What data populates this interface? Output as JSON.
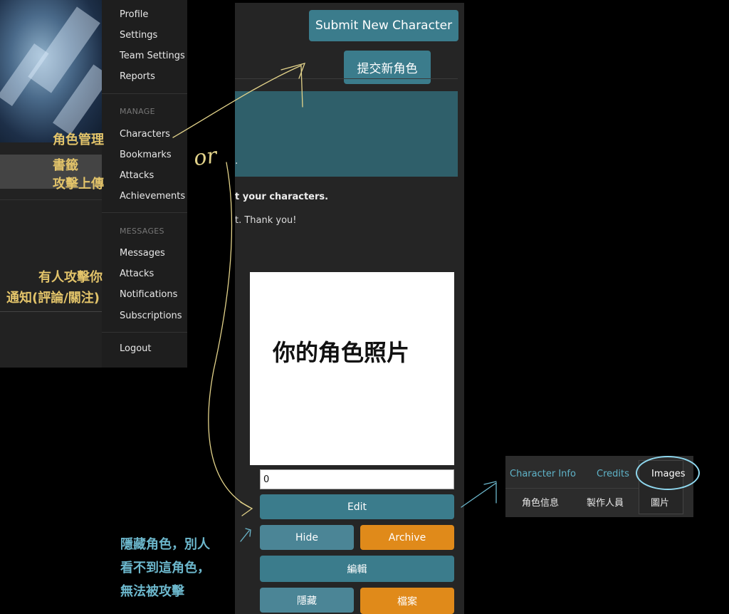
{
  "menu": {
    "account_items": [
      "Profile",
      "Settings",
      "Team Settings",
      "Reports"
    ],
    "manage_heading": "MANAGE",
    "manage_items": [
      "Characters",
      "Bookmarks",
      "Attacks",
      "Achievements"
    ],
    "messages_heading": "MESSAGES",
    "messages_items": [
      "Messages",
      "Attacks",
      "Notifications",
      "Subscriptions"
    ],
    "logout": "Logout"
  },
  "annotations_left": {
    "characters_zh": "角色管理",
    "bookmarks_zh": "書籤",
    "attacks_upload_zh": "攻擊上傳",
    "attacked_zh": "有人攻擊你",
    "notifications_zh": "通知(評論/關注)"
  },
  "handwritten_or": "or",
  "main": {
    "submit_en": "Submit New Character",
    "submit_zh": "提交新角色",
    "info_box_fragment": ".",
    "info_line1": "t your characters.",
    "info_line2": "t. Thank you!",
    "photo_label": "你的角色照片",
    "number_value": "0",
    "edit_label": "Edit",
    "hide_label": "Hide",
    "archive_label": "Archive",
    "edit_zh": "編輯",
    "hide_zh": "隱藏",
    "archive_zh": "檔案"
  },
  "hide_note": {
    "line1": "隱藏角色，別人",
    "line2": "看不到這角色，",
    "line3": "無法被攻擊"
  },
  "tabs": {
    "character_info": "Character Info",
    "credits": "Credits",
    "images": "Images",
    "character_info_zh": "角色信息",
    "credits_zh": "製作人員",
    "images_zh": "圖片"
  },
  "colors": {
    "teal": "#3b7c8c",
    "orange": "#e08a1a",
    "annotation_gold": "#e3c46a",
    "annotation_blue": "#6cb7cc",
    "tab_link": "#5fb3c8"
  }
}
